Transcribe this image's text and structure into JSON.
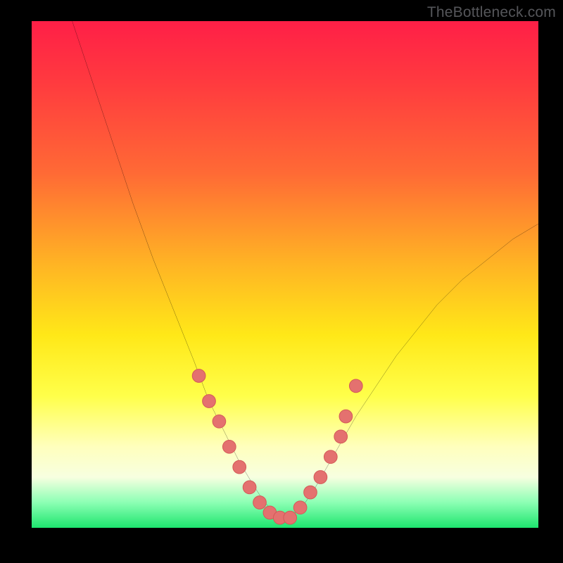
{
  "watermark": "TheBottleneck.com",
  "chart_data": {
    "type": "line",
    "title": "",
    "xlabel": "",
    "ylabel": "",
    "xlim": [
      0,
      100
    ],
    "ylim": [
      0,
      100
    ],
    "series": [
      {
        "name": "curve",
        "x": [
          8,
          12,
          16,
          20,
          24,
          28,
          32,
          35,
          38,
          41,
          44,
          46,
          48,
          50,
          52,
          54,
          56,
          60,
          64,
          68,
          72,
          76,
          80,
          85,
          90,
          95,
          100
        ],
        "y": [
          100,
          88,
          76,
          64,
          53,
          43,
          33,
          25,
          19,
          13,
          8,
          5,
          3,
          2,
          3,
          5,
          8,
          15,
          22,
          28,
          34,
          39,
          44,
          49,
          53,
          57,
          60
        ]
      }
    ],
    "markers": [
      {
        "x": 33,
        "y": 30
      },
      {
        "x": 35,
        "y": 25
      },
      {
        "x": 37,
        "y": 21
      },
      {
        "x": 39,
        "y": 16
      },
      {
        "x": 41,
        "y": 12
      },
      {
        "x": 43,
        "y": 8
      },
      {
        "x": 45,
        "y": 5
      },
      {
        "x": 47,
        "y": 3
      },
      {
        "x": 49,
        "y": 2
      },
      {
        "x": 51,
        "y": 2
      },
      {
        "x": 53,
        "y": 4
      },
      {
        "x": 55,
        "y": 7
      },
      {
        "x": 57,
        "y": 10
      },
      {
        "x": 59,
        "y": 14
      },
      {
        "x": 61,
        "y": 18
      },
      {
        "x": 62,
        "y": 22
      },
      {
        "x": 64,
        "y": 28
      }
    ],
    "marker_color": "#e4716f",
    "gradient_stops": [
      {
        "pos": 0,
        "color": "#ff1f47"
      },
      {
        "pos": 30,
        "color": "#ff6a35"
      },
      {
        "pos": 62,
        "color": "#ffe818"
      },
      {
        "pos": 90,
        "color": "#f7ffe0"
      },
      {
        "pos": 100,
        "color": "#1de56e"
      }
    ]
  }
}
